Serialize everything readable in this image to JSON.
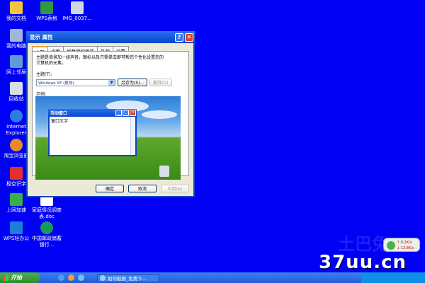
{
  "desktop_icons": [
    {
      "label": "我的文档",
      "color": "#f5c542"
    },
    {
      "label": "WPS表格",
      "color": "#2e9a3e"
    },
    {
      "label": "IMG_0037...",
      "color": "#cfd8e0"
    },
    {
      "label": "我的电脑",
      "color": "#9fb6d8"
    },
    {
      "label": "网上邻居",
      "color": "#5f9bd8"
    },
    {
      "label": "回收站",
      "color": "#d6dfe8"
    },
    {
      "label": "Internet Explorer",
      "color": "#2a7fe0"
    },
    {
      "label": "淘宝浏览器",
      "color": "#e98a2a"
    },
    {
      "label": "极空识字",
      "color": "#e03030"
    },
    {
      "label": "上网加速",
      "color": "#35b04a"
    },
    {
      "label": "家庭情况调查表.doc",
      "color": "#ffffff"
    },
    {
      "label": "WPS轻办公",
      "color": "#1d7fd4"
    },
    {
      "label": "中国邮政储蓄银行...",
      "color": "#1a9a5a"
    }
  ],
  "dialog": {
    "title": "显示 属性",
    "help_label": "?",
    "close_label": "✕",
    "tabs": [
      "主题",
      "桌面",
      "屏幕保护程序",
      "外观",
      "设置"
    ],
    "description": "主题是背景加一组声音，图标以及只需单击即可帮您个性化设置您的计算机的元素。",
    "theme_label": "主题(T):",
    "theme_value": "Windows XP (更改)",
    "save_as_label": "另存为(S)...",
    "delete_label": "删除(D)",
    "preview_label": "示例:",
    "preview_window_title": "活动窗口",
    "preview_window_text": "窗口文字",
    "ok_label": "确定",
    "cancel_label": "取消",
    "apply_label": "应用(A)"
  },
  "taskbar": {
    "start_label": "开始",
    "task_item_label": "如何截图_免费下..."
  },
  "net_widget": {
    "up": "↑ 0.2K/s",
    "down": "↓ 13.8K/s"
  },
  "watermark": {
    "text": "37uu.cn",
    "faint_text": "土巴兔"
  }
}
